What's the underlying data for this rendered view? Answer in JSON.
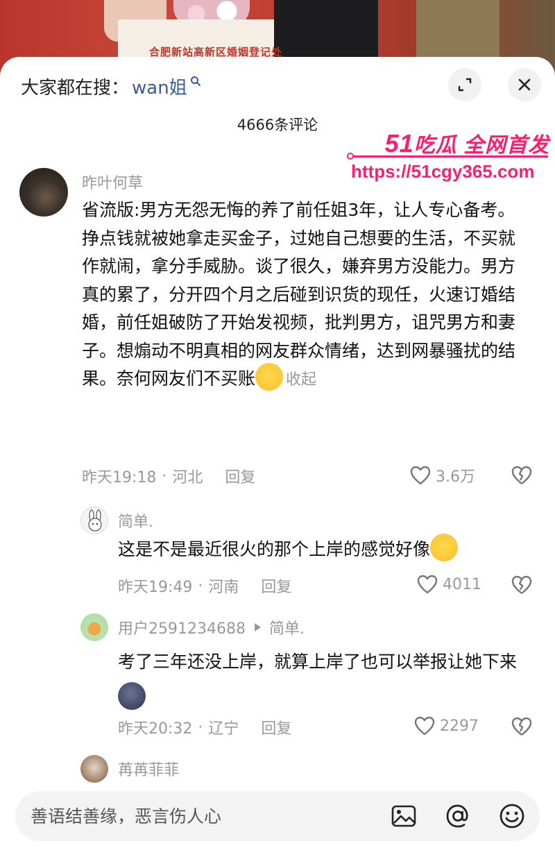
{
  "background": {
    "sign_text": "合肥新站高新区婚姻登记处"
  },
  "header": {
    "search_prefix": "大家都在搜：",
    "search_term": "wan姐",
    "comment_count": "4666条评论"
  },
  "watermark": {
    "brand_num": "51",
    "brand_text": "吃瓜 全网首发",
    "url": "https://51cgy365.com"
  },
  "comments": [
    {
      "username": "昨叶何草",
      "text": "省流版:男方无怨无悔的养了前任姐3年，让人专心备考。挣点钱就被她拿走买金子，过她自己想要的生活，不买就作就闹，拿分手威胁。谈了很久，嫌弃男方没能力。男方真的累了，分开四个月之后碰到识货的现任，火速订婚结婚，前任姐破防了开始发视频，批判男方，诅咒男方和妻子。想煽动不明真相的网友群众情绪，达到网暴骚扰的结果。奈何网友们不买账",
      "collapse_label": "收起",
      "time": "昨天19:18",
      "location": "河北",
      "reply_label": "回复",
      "likes": "3.6万"
    },
    {
      "username": "简单.",
      "text": "这是不是最近很火的那个上岸的感觉好像",
      "time": "昨天19:49",
      "location": "河南",
      "reply_label": "回复",
      "likes": "4011"
    },
    {
      "username": "用户2591234688",
      "reply_to": "简单.",
      "text": "考了三年还没上岸，就算上岸了也可以举报让她下来",
      "time": "昨天20:32",
      "location": "辽宁",
      "reply_label": "回复",
      "likes": "2297"
    },
    {
      "username": "苒苒菲菲"
    }
  ],
  "input": {
    "placeholder": "善语结善缘，恶言伤人心"
  },
  "icons": {
    "expand": "expand-icon",
    "close": "close-icon",
    "like": "heart-icon",
    "dislike": "broken-heart-icon",
    "image": "image-icon",
    "mention": "at-icon",
    "emoji": "smiley-icon"
  }
}
